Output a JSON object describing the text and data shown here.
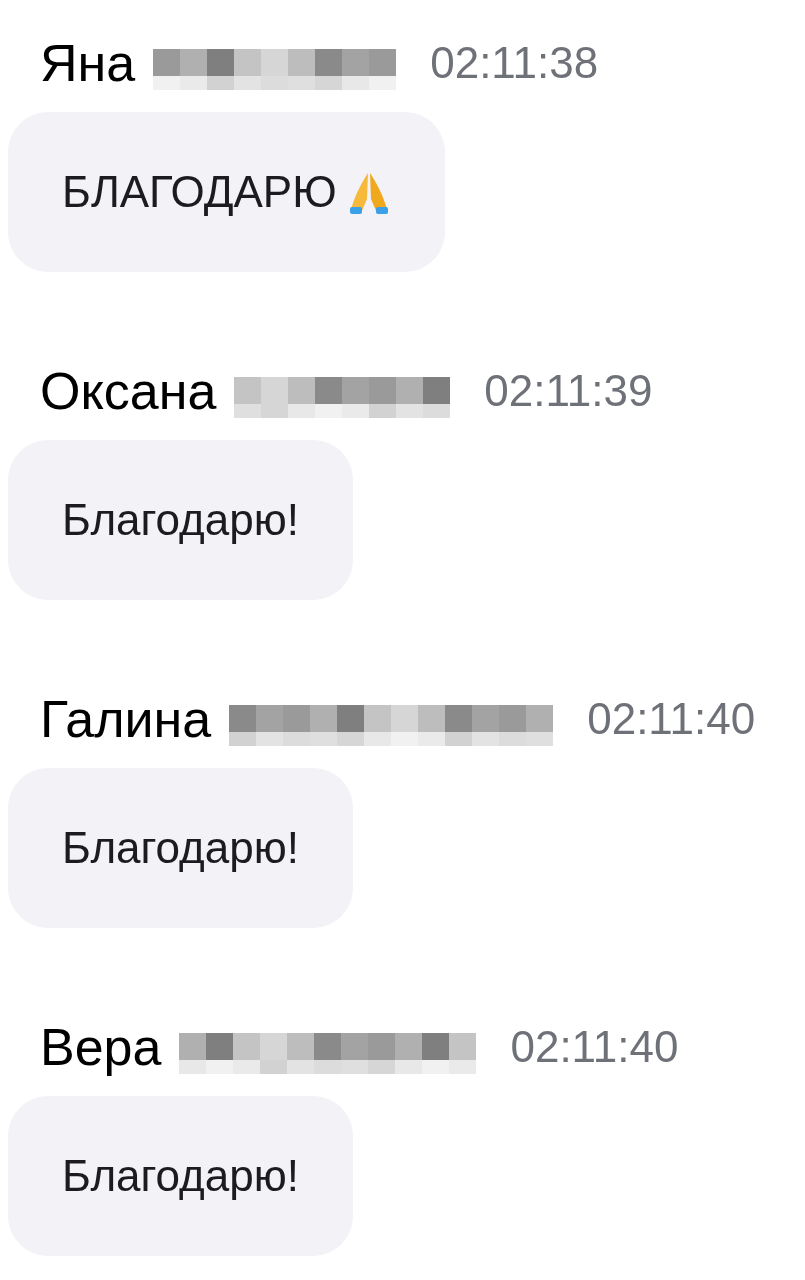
{
  "messages": [
    {
      "author": "Яна",
      "time": "02:11:38",
      "text": "БЛАГОДАРЮ",
      "kind": "emoji"
    },
    {
      "author": "Оксана",
      "time": "02:11:39",
      "text": "Благодарю!",
      "kind": "plain"
    },
    {
      "author": "Галина",
      "time": "02:11:40",
      "text": "Благодарю!",
      "kind": "plain"
    },
    {
      "author": "Вера",
      "time": "02:11:40",
      "text": "Благодарю!",
      "kind": "plain"
    }
  ]
}
